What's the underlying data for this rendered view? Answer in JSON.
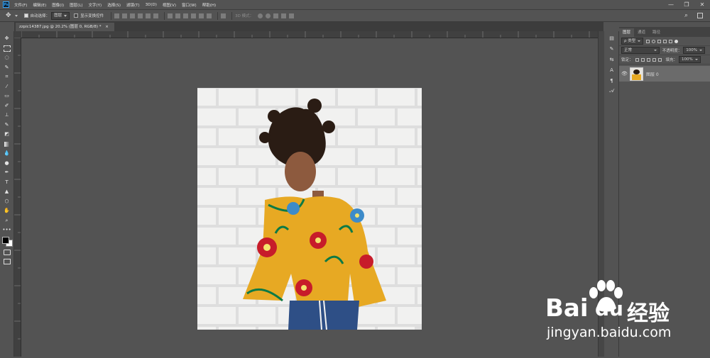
{
  "app": {
    "logo": "Ps"
  },
  "menu": [
    "文件(F)",
    "编辑(E)",
    "图像(I)",
    "图层(L)",
    "文字(Y)",
    "选择(S)",
    "滤镜(T)",
    "3D(D)",
    "视图(V)",
    "窗口(W)",
    "帮助(H)"
  ],
  "window_controls": {
    "minimize": "—",
    "restore": "❐",
    "close": "✕"
  },
  "options": {
    "move_icon": "move-tool-icon",
    "auto_select_label": "自动选择：",
    "auto_select_value": "图层",
    "show_transform_label": "显示变换控件",
    "mode_3d_label": "3D 模式："
  },
  "document_tab": {
    "title": "zzpic14387.jpg @ 20.2% (图层 0, RGB/8) *",
    "close": "×"
  },
  "tools": [
    "move",
    "marquee",
    "lasso",
    "quick-select",
    "crop",
    "eyedropper",
    "healing",
    "brush",
    "stamp",
    "history-brush",
    "eraser",
    "gradient",
    "blur",
    "dodge",
    "pen",
    "type",
    "path-select",
    "shape",
    "hand",
    "zoom",
    "more"
  ],
  "tool_glyphs": {
    "type": "T",
    "more": "•••",
    "hand": "✋",
    "zoom": "⌕"
  },
  "panel": {
    "tabs": [
      "图层",
      "通道",
      "路径"
    ],
    "filter_label": "ρ 类型",
    "blend_mode": "正常",
    "opacity_label": "不透明度：",
    "opacity_value": "100%",
    "lock_label": "锁定：",
    "fill_label": "填充：",
    "fill_value": "100%",
    "layer_name": "图层 0"
  },
  "right_strip_glyphs": [
    "A",
    "¶"
  ],
  "watermark": {
    "brand": "Bai",
    "brand2": "du",
    "cn": "经验",
    "url": "jingyan.baidu.com"
  },
  "colors": {
    "accent": "#31a8ff",
    "shirt": "#e7a923",
    "jeans": "#2e4f86",
    "brick": "#ececec"
  }
}
